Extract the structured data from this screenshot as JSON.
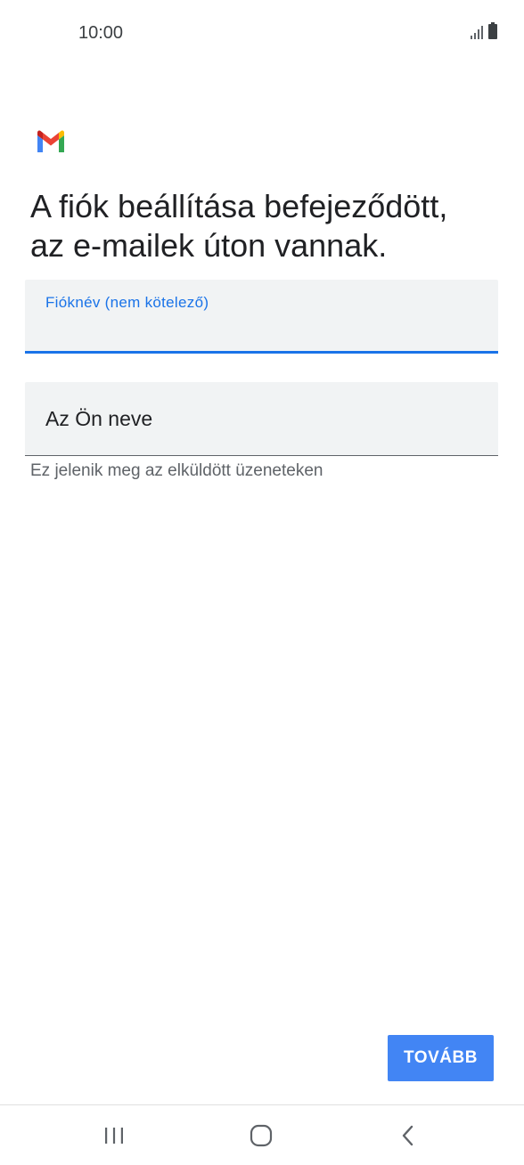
{
  "status_bar": {
    "time": "10:00",
    "icons": [
      "signal-icon",
      "battery-icon"
    ]
  },
  "app": {
    "logo_icon": "gmail-logo-icon",
    "brand_colors": {
      "blue": "#4285F4",
      "red": "#EA4335",
      "yellow": "#FBBC04",
      "green": "#34A853",
      "darkred": "#C5221F"
    }
  },
  "page": {
    "title_line1": "A fiók beállítása befejeződött,",
    "title_line2": "az e-mailek úton vannak."
  },
  "form": {
    "account_name": {
      "label": "Fióknév (nem kötelező)",
      "value": ""
    },
    "your_name": {
      "placeholder": "Az Ön neve",
      "helper": "Ez jelenik meg az elküldött üzeneteken"
    }
  },
  "actions": {
    "next_label": "TOVÁBB"
  },
  "nav_bar": {
    "icons": [
      "recent-apps-icon",
      "home-icon",
      "back-icon"
    ]
  }
}
